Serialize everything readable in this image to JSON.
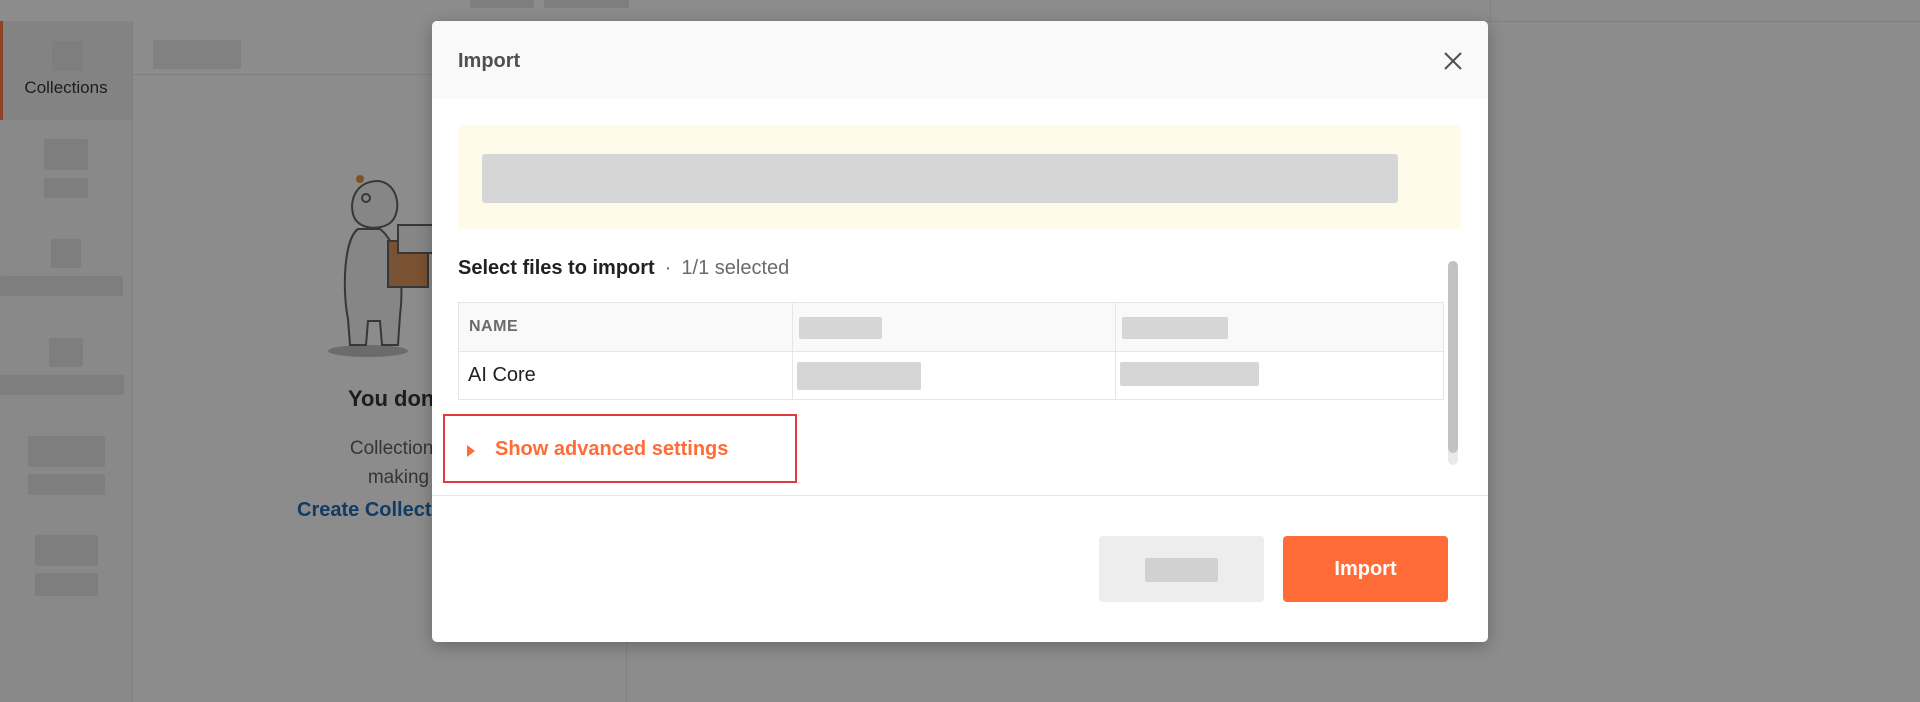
{
  "sidebar": {
    "items": [
      {
        "label": "Collections"
      }
    ]
  },
  "collections_panel": {
    "empty_title": "You don’t have any c",
    "empty_desc_line1": "Collections let you group re",
    "empty_desc_line2": "making them easier to ac",
    "create_link": "Create Collect"
  },
  "modal": {
    "title": "Import",
    "close_icon": "close-icon",
    "select_label": "Select files to import",
    "separator": "·",
    "selected_count": "1/1 selected",
    "table": {
      "headers": [
        "NAME",
        "",
        ""
      ],
      "rows": [
        {
          "name": "AI Core"
        }
      ]
    },
    "advanced_settings": "Show advanced settings",
    "import_button": "Import"
  },
  "colors": {
    "accent": "#ff6c37",
    "link": "#0b5cad",
    "highlight_border": "#e0393e",
    "notice_bg": "#fffbea"
  }
}
